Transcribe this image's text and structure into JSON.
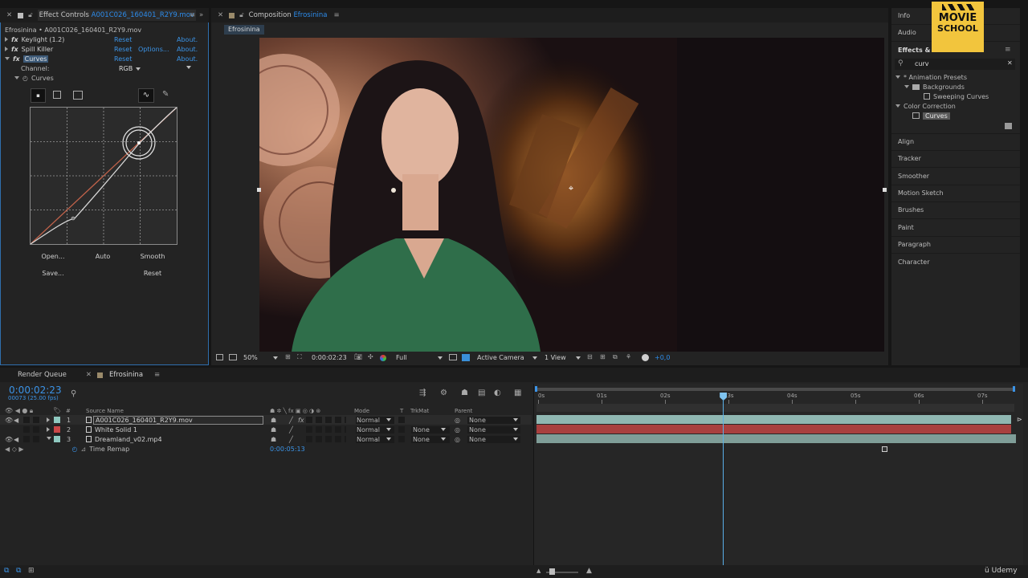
{
  "effect_controls": {
    "tab_label": "Effect Controls",
    "tab_file": "A001C026_160401_R2Y9.mov",
    "breadcrumb": "Efrosinina • A001C026_160401_R2Y9.mov",
    "effects": [
      {
        "name": "Keylight (1.2)",
        "reset": "Reset",
        "options": "",
        "about": "About."
      },
      {
        "name": "Spill Killer",
        "reset": "Reset",
        "options": "Options...",
        "about": "About."
      },
      {
        "name": "Curves",
        "reset": "Reset",
        "options": "",
        "about": "About."
      }
    ],
    "channel_label": "Channel:",
    "channel_value": "RGB",
    "curves_label": "Curves",
    "buttons": {
      "open": "Open...",
      "auto": "Auto",
      "smooth": "Smooth",
      "save": "Save...",
      "reset": "Reset"
    }
  },
  "composition": {
    "tab_label": "Composition",
    "tab_name": "Efrosinina",
    "view_tab": "Efrosinina",
    "toolbar": {
      "zoom": "50%",
      "timecode": "0:00:02:23",
      "resolution": "Full",
      "camera": "Active Camera",
      "views": "1 View",
      "exposure": "+0,0"
    }
  },
  "right_panel": {
    "info": "Info",
    "audio": "Audio",
    "effects_title": "Effects & I",
    "search_value": "curv",
    "tree": {
      "animation_presets": "* Animation Presets",
      "backgrounds": "Backgrounds",
      "sweeping_curves": "Sweeping Curves",
      "color_correction": "Color Correction",
      "curves": "Curves"
    },
    "panels": [
      "Align",
      "Tracker",
      "Smoother",
      "Motion Sketch",
      "Brushes",
      "Paint",
      "Paragraph",
      "Character"
    ],
    "logo_line1": "MOVIE",
    "logo_line2": "SCHOOL"
  },
  "timeline": {
    "render_queue_tab": "Render Queue",
    "comp_tab": "Efrosinina",
    "timecode": "0:00:02:23",
    "frames": "00073 (25.00 fps)",
    "columns": {
      "num": "#",
      "source": "Source Name",
      "mode": "Mode",
      "t": "T",
      "trkmat": "TrkMat",
      "parent": "Parent"
    },
    "layers": [
      {
        "num": "1",
        "name": "A001C026_160401_R2Y9.mov",
        "mode": "Normal",
        "trkmat": "",
        "parent": "None",
        "color": "#8fc9c0"
      },
      {
        "num": "2",
        "name": "White Solid 1",
        "mode": "Normal",
        "trkmat": "None",
        "parent": "None",
        "color": "#c94848"
      },
      {
        "num": "3",
        "name": "Dreamland_v02.mp4",
        "mode": "Normal",
        "trkmat": "None",
        "parent": "None",
        "color": "#8fc9c0"
      }
    ],
    "time_remap_label": "Time Remap",
    "time_remap_value": "0:00:05:13",
    "ruler": [
      "0s",
      "01s",
      "02s",
      "03s",
      "04s",
      "05s",
      "06s",
      "07s"
    ],
    "playhead_seconds": 2.92
  },
  "watermark": "Udemy"
}
